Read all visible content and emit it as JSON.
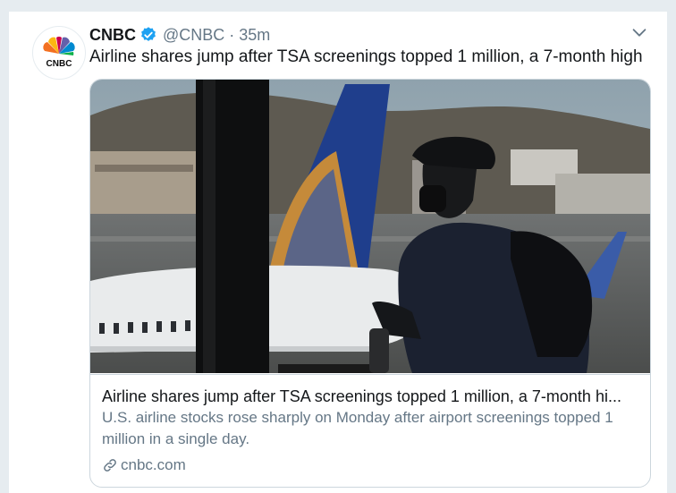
{
  "tweet": {
    "author_name": "CNBC",
    "handle": "@CNBC",
    "separator": "·",
    "time": "35m",
    "text": "Airline shares jump after TSA screenings topped 1 million, a 7-month high",
    "avatar_logo_text": "CNBC",
    "verified_icon": "verified-badge-icon",
    "menu_icon": "chevron-down-icon"
  },
  "card": {
    "title": "Airline shares jump after TSA screenings topped 1 million, a 7-month hi...",
    "description": "U.S. airline stocks rose sharply on Monday after airport screenings topped 1 million in a single day.",
    "domain": "cnbc.com",
    "link_icon": "link-icon"
  },
  "colors": {
    "brand_blue": "#1da1f2",
    "secondary_text": "#657786",
    "border": "#ccd6dd"
  }
}
